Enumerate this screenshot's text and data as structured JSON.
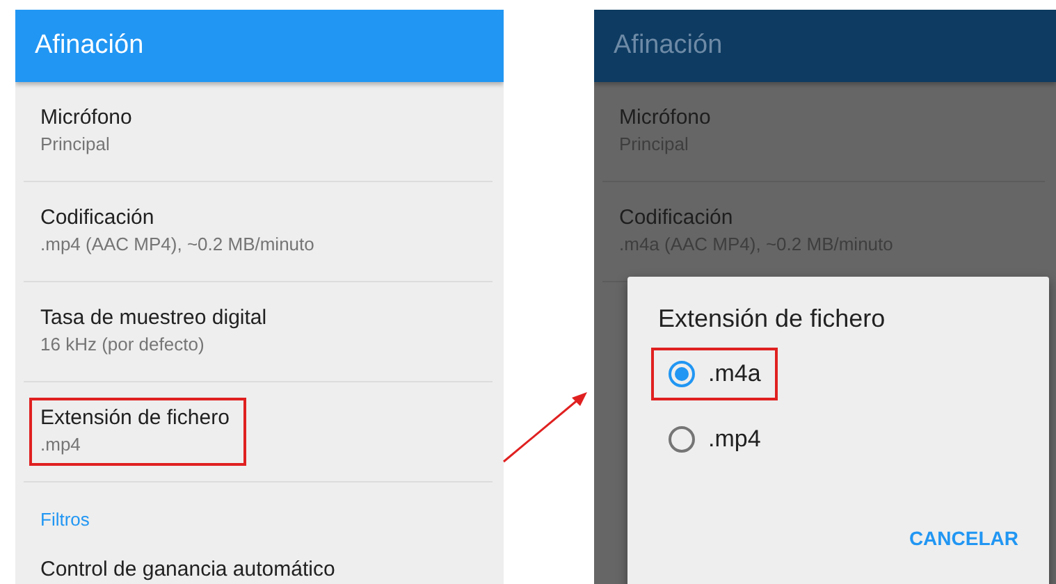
{
  "left_screen": {
    "header": {
      "title": "Afinación"
    },
    "items": [
      {
        "kind": "setting",
        "title": "Micrófono",
        "subtitle": "Principal",
        "highlighted": false
      },
      {
        "kind": "setting",
        "title": "Codificación",
        "subtitle": ".mp4 (AAC MP4), ~0.2 MB/minuto",
        "highlighted": false
      },
      {
        "kind": "setting",
        "title": "Tasa de muestreo digital",
        "subtitle": "16 kHz (por defecto)",
        "highlighted": false
      },
      {
        "kind": "setting",
        "title": "Extensión de fichero",
        "subtitle": ".mp4",
        "highlighted": true
      },
      {
        "kind": "category",
        "title": "Filtros"
      },
      {
        "kind": "setting",
        "title": "Control de ganancia automático",
        "highlighted": false
      }
    ]
  },
  "right_screen": {
    "header": {
      "title": "Afinación"
    },
    "items": [
      {
        "kind": "setting",
        "title": "Micrófono",
        "subtitle": "Principal"
      },
      {
        "kind": "setting",
        "title": "Codificación",
        "subtitle": ".m4a (AAC MP4), ~0.2 MB/minuto"
      }
    ],
    "dialog": {
      "title": "Extensión de fichero",
      "options": [
        {
          "label": ".m4a",
          "selected": true,
          "highlighted": true
        },
        {
          "label": ".mp4",
          "selected": false,
          "highlighted": false
        }
      ],
      "button": "CANCELAR"
    }
  }
}
